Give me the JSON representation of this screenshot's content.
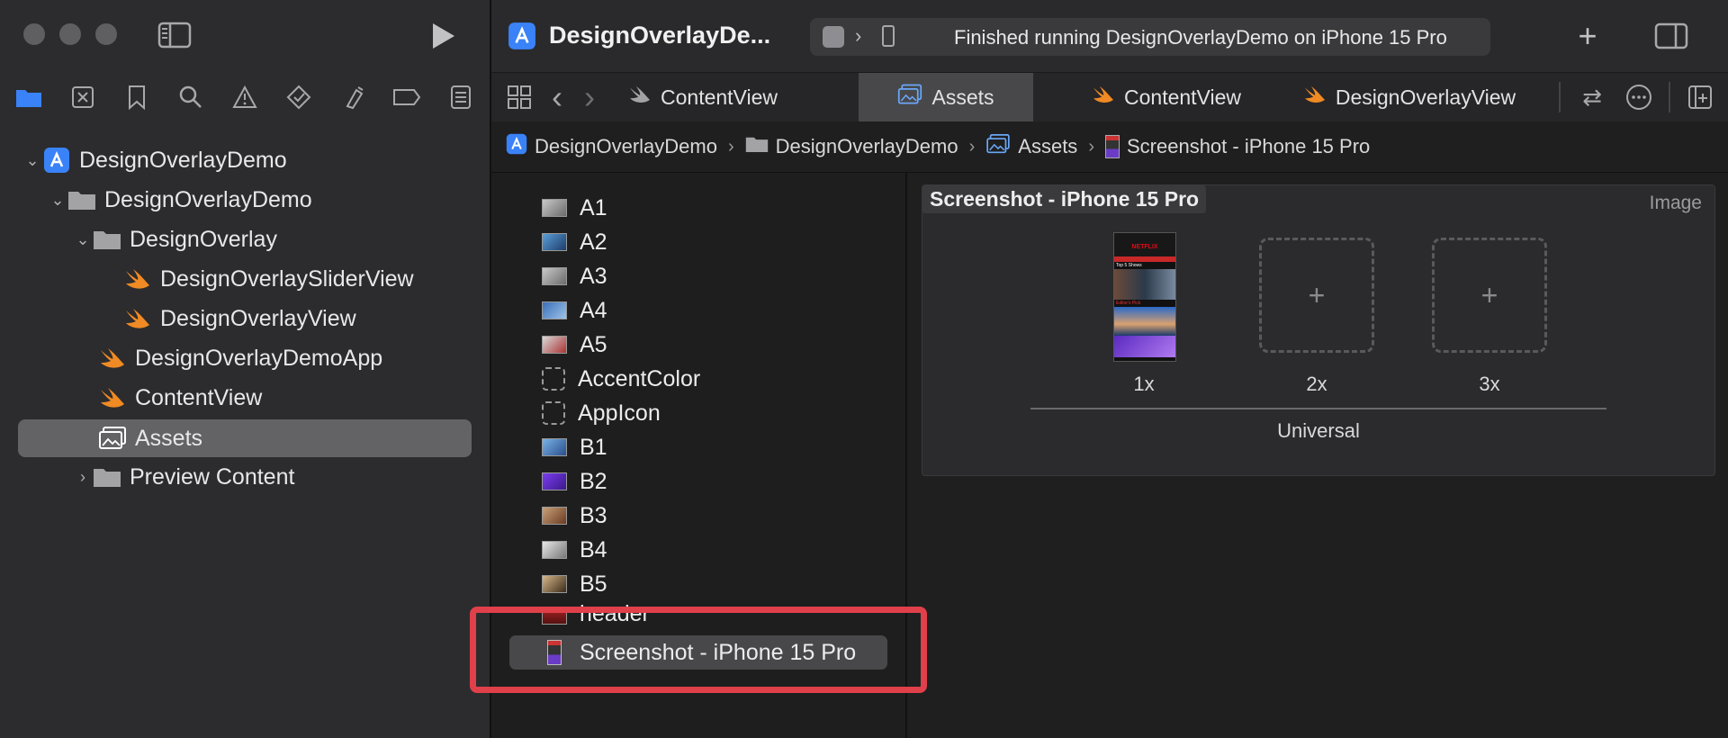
{
  "window": {
    "project_title": "DesignOverlayDe...",
    "status_text": "Finished running DesignOverlayDemo on iPhone 15 Pro"
  },
  "navigator": {
    "icons": [
      "folder-icon",
      "source-control-icon",
      "bookmark-icon",
      "search-icon",
      "warning-icon",
      "test-icon",
      "debug-icon",
      "breakpoint-icon",
      "report-icon"
    ],
    "tree": [
      {
        "label": "DesignOverlayDemo",
        "kind": "project",
        "expanded": true
      },
      {
        "label": "DesignOverlayDemo",
        "kind": "folder",
        "expanded": true
      },
      {
        "label": "DesignOverlay",
        "kind": "folder",
        "expanded": true
      },
      {
        "label": "DesignOverlaySliderView",
        "kind": "swift"
      },
      {
        "label": "DesignOverlayView",
        "kind": "swift"
      },
      {
        "label": "DesignOverlayDemoApp",
        "kind": "swift"
      },
      {
        "label": "ContentView",
        "kind": "swift"
      },
      {
        "label": "Assets",
        "kind": "assets",
        "selected": true
      },
      {
        "label": "Preview Content",
        "kind": "folder",
        "expanded": false
      }
    ]
  },
  "tabs": [
    {
      "label": "ContentView",
      "active": false
    },
    {
      "label": "Assets",
      "active": true
    },
    {
      "label": "ContentView",
      "active": false
    },
    {
      "label": "DesignOverlayView",
      "active": false
    }
  ],
  "breadcrumb": [
    "DesignOverlayDemo",
    "DesignOverlayDemo",
    "Assets",
    "Screenshot - iPhone 15 Pro"
  ],
  "assets": [
    {
      "label": "A1",
      "kind": "image"
    },
    {
      "label": "A2",
      "kind": "image"
    },
    {
      "label": "A3",
      "kind": "image"
    },
    {
      "label": "A4",
      "kind": "image"
    },
    {
      "label": "A5",
      "kind": "image"
    },
    {
      "label": "AccentColor",
      "kind": "color"
    },
    {
      "label": "AppIcon",
      "kind": "appicon"
    },
    {
      "label": "B1",
      "kind": "image"
    },
    {
      "label": "B2",
      "kind": "image"
    },
    {
      "label": "B3",
      "kind": "image"
    },
    {
      "label": "B4",
      "kind": "image"
    },
    {
      "label": "B5",
      "kind": "image"
    },
    {
      "label": "header",
      "kind": "image"
    },
    {
      "label": "Screenshot - iPhone 15 Pro",
      "kind": "image",
      "selected": true
    }
  ],
  "detail": {
    "title": "Screenshot - iPhone 15 Pro",
    "type_label": "Image",
    "slots": [
      {
        "label": "1x",
        "filled": true
      },
      {
        "label": "2x",
        "filled": false
      },
      {
        "label": "3x",
        "filled": false
      }
    ],
    "group_label": "Universal",
    "thumbnail": {
      "brand": "NETFLIX",
      "section_1": "Top 5 Shows",
      "section_2": "Editor's Pick"
    }
  },
  "colors": {
    "accent_blue": "#3a82f7",
    "swift_orange": "#f08a24",
    "highlight_red": "#e0404a"
  }
}
